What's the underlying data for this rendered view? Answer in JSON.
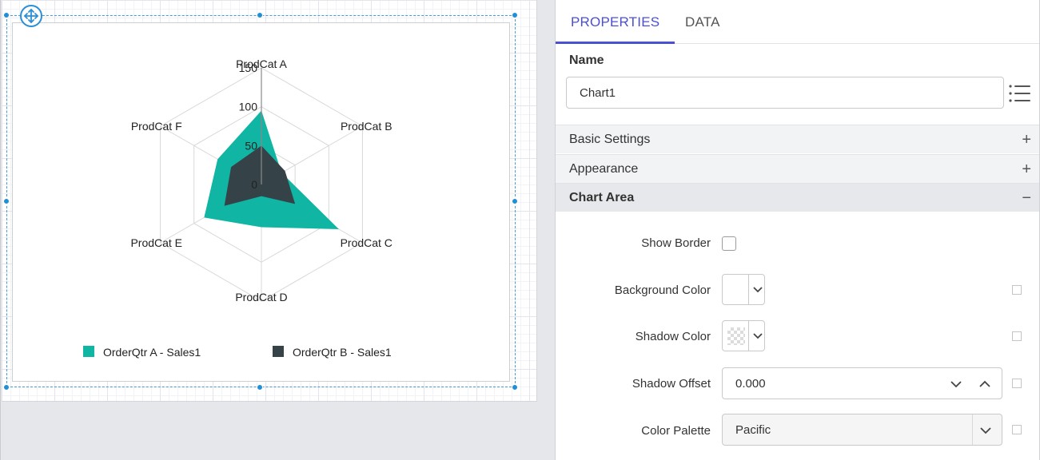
{
  "colors": {
    "series_a": "#10b5a3",
    "series_b": "#354349",
    "accent": "#4b4fd1",
    "handle": "#1f8fd6"
  },
  "tabs": [
    {
      "label": "PROPERTIES",
      "active": true
    },
    {
      "label": "DATA",
      "active": false
    }
  ],
  "name_section": {
    "label": "Name",
    "value": "Chart1",
    "menu_icon": "list-icon"
  },
  "sections": [
    {
      "label": "Basic Settings",
      "sign": "+"
    },
    {
      "label": "Appearance",
      "sign": "+"
    },
    {
      "label": "Chart Area",
      "sign": "−"
    }
  ],
  "chart_area_props": {
    "show_border": {
      "label": "Show Border",
      "checked": false
    },
    "background_color": {
      "label": "Background Color",
      "value": "#ffffff"
    },
    "shadow_color": {
      "label": "Shadow Color",
      "value": "transparent"
    },
    "shadow_offset": {
      "label": "Shadow Offset",
      "value": "0.000"
    },
    "color_palette": {
      "label": "Color Palette",
      "value": "Pacific"
    }
  },
  "chart_data": {
    "type": "radar",
    "categories": [
      "ProdCat A",
      "ProdCat B",
      "ProdCat C",
      "ProdCat D",
      "ProdCat E",
      "ProdCat F"
    ],
    "axis_ticks": [
      0,
      50,
      100,
      150
    ],
    "ylim": [
      0,
      150
    ],
    "series": [
      {
        "name": "OrderQtr A - Sales1",
        "color": "#10b5a3",
        "values": [
          95,
          30,
          115,
          55,
          85,
          65
        ]
      },
      {
        "name": "OrderQtr B - Sales1",
        "color": "#354349",
        "values": [
          50,
          35,
          50,
          15,
          55,
          45
        ]
      }
    ],
    "grid": true,
    "legend": "bottom-left"
  }
}
